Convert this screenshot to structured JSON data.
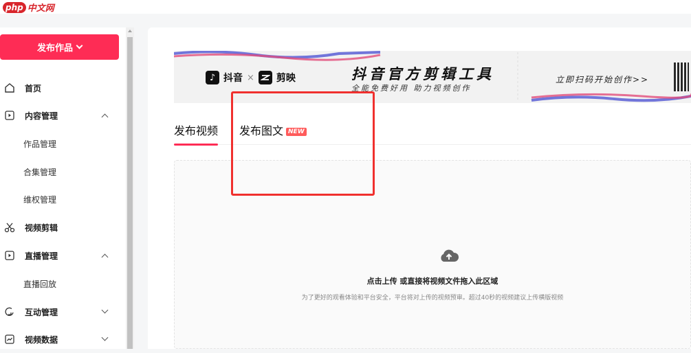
{
  "header": {
    "logo_badge": "php",
    "logo_text": "中文网"
  },
  "sidebar": {
    "publish_label": "发布作品",
    "items": [
      {
        "label": "首页",
        "icon": "home-icon"
      },
      {
        "label": "内容管理",
        "icon": "play-box-icon",
        "expanded": true
      },
      {
        "label": "作品管理"
      },
      {
        "label": "合集管理"
      },
      {
        "label": "维权管理"
      },
      {
        "label": "视频剪辑",
        "icon": "scissors-icon"
      },
      {
        "label": "直播管理",
        "icon": "play-box-icon",
        "expanded": true
      },
      {
        "label": "直播回放"
      },
      {
        "label": "互动管理",
        "icon": "chat-icon",
        "expanded": false
      },
      {
        "label": "视频数据",
        "icon": "chart-icon",
        "expanded": false
      }
    ]
  },
  "banner": {
    "douyin": "抖音",
    "times": "×",
    "capcut": "剪映",
    "title": "抖音官方剪辑工具",
    "subtitle": "全能免费好用 助力视频创作",
    "cta": "立即扫码开始创作>>"
  },
  "tabs": [
    {
      "label": "发布视频",
      "active": true
    },
    {
      "label": "发布图文",
      "badge": "NEW",
      "active": false
    }
  ],
  "upload": {
    "main_text": "点击上传 或直接将视频文件拖入此区域",
    "hint_text": "为了更好的观看体验和平台安全，平台将对上传的视频预审。超过40秒的视频建议上传横版视频"
  },
  "colors": {
    "accent": "#fe2c55",
    "highlight": "#f0302e"
  }
}
